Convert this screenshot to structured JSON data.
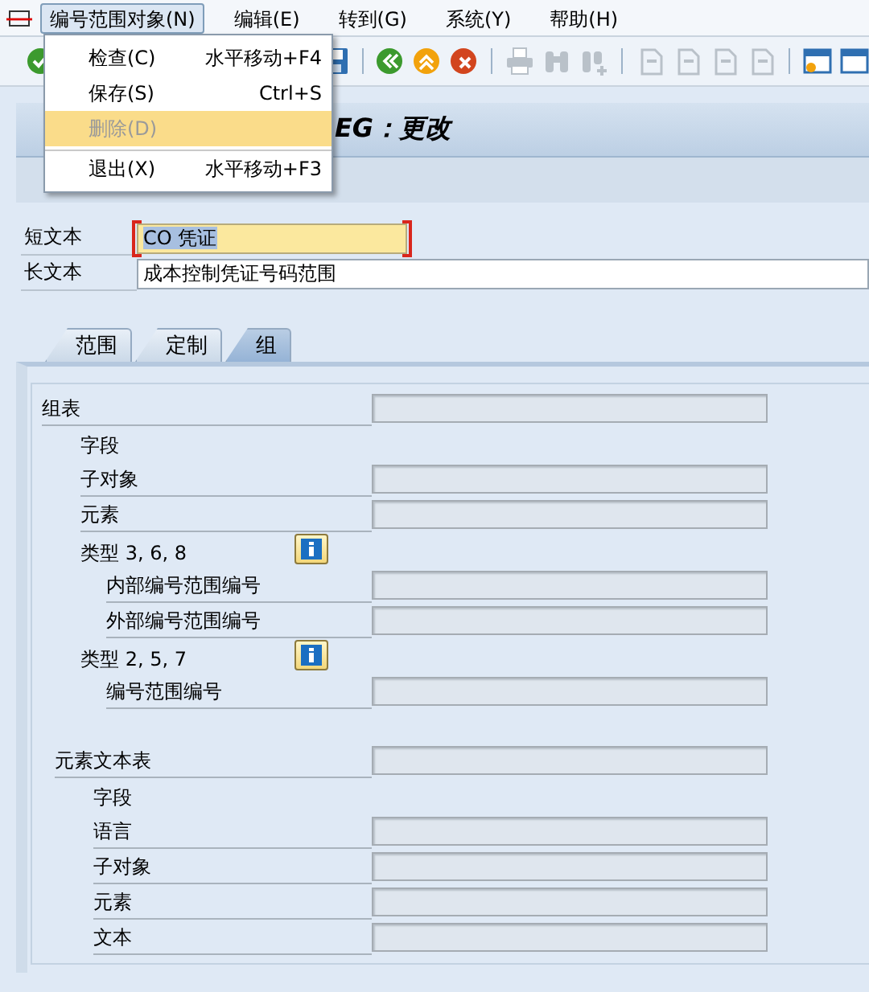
{
  "menu_bar": [
    {
      "label": "编号范围对象(N)",
      "selected": true
    },
    {
      "label": "编辑(E)",
      "selected": false
    },
    {
      "label": "转到(G)",
      "selected": false
    },
    {
      "label": "系统(Y)",
      "selected": false
    },
    {
      "label": "帮助(H)",
      "selected": false
    }
  ],
  "dropdown": {
    "items": [
      {
        "label": "检查(C)",
        "shortcut": "水平移动+F4",
        "disabled": false,
        "selected": false,
        "separator_before": false
      },
      {
        "label": "保存(S)",
        "shortcut": "Ctrl+S",
        "disabled": false,
        "selected": false,
        "separator_before": false
      },
      {
        "label": "删除(D)",
        "disabled": true,
        "selected": true,
        "separator_before": false
      },
      {
        "label": "退出(X)",
        "shortcut": "水平移动+F3",
        "disabled": false,
        "selected": false,
        "separator_before": true
      }
    ]
  },
  "title": "EG：更改",
  "fields": [
    {
      "label": "短文本",
      "value": "CO 凭证",
      "focused": true,
      "selected": true
    },
    {
      "label": "长文本",
      "value": "成本控制凭证号码范围",
      "focused": false,
      "selected": false
    }
  ],
  "tabs": [
    {
      "label": "范围",
      "selected": false
    },
    {
      "label": "定制",
      "selected": false
    },
    {
      "label": "组",
      "selected": true
    }
  ],
  "groups": [
    {
      "label": "组表",
      "kind": "input",
      "children": [
        {
          "label": "字段",
          "kind": "label"
        },
        {
          "label": "子对象",
          "kind": "input"
        },
        {
          "label": "元素",
          "kind": "input"
        },
        {
          "label": "类型 3, 6, 8",
          "kind": "info",
          "children": [
            {
              "label": "内部编号范围编号",
              "kind": "input"
            },
            {
              "label": "外部编号范围编号",
              "kind": "input"
            }
          ]
        },
        {
          "label": "类型 2, 5, 7",
          "kind": "info",
          "children": [
            {
              "label": "编号范围编号",
              "kind": "input"
            }
          ]
        }
      ]
    },
    {
      "label": "元素文本表",
      "kind": "input",
      "children": [
        {
          "label": "字段",
          "kind": "label"
        },
        {
          "label": "语言",
          "kind": "input"
        },
        {
          "label": "子对象",
          "kind": "input"
        },
        {
          "label": "元素",
          "kind": "input"
        },
        {
          "label": "文本",
          "kind": "input"
        }
      ]
    }
  ]
}
